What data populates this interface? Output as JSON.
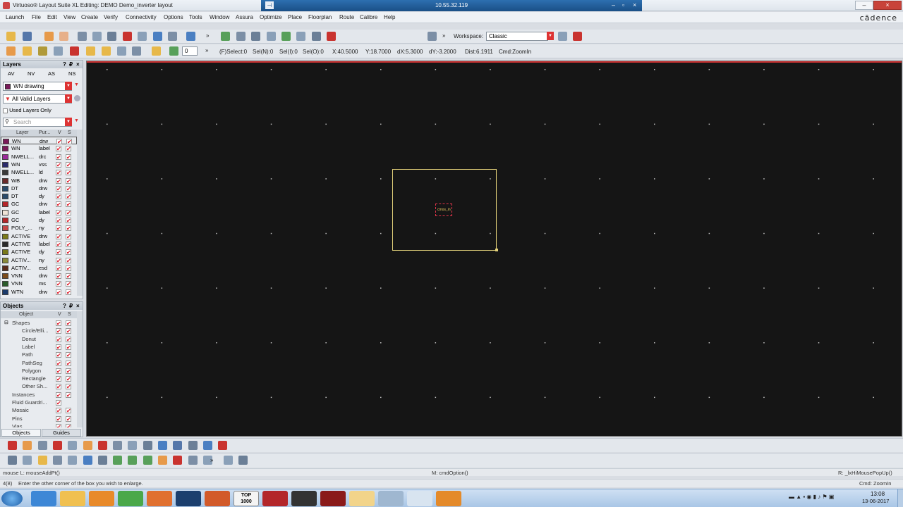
{
  "window": {
    "title": "Virtuoso® Layout Suite XL Editing: DEMO Demo_inverter layout",
    "remote_ip": "10.55.32.119",
    "brand": "cādence"
  },
  "menu": [
    "Launch",
    "File",
    "Edit",
    "View",
    "Create",
    "Verify",
    "Connectivity",
    "Options",
    "Tools",
    "Window",
    "Assura",
    "Optimize",
    "Place",
    "Floorplan",
    "Route",
    "Calibre",
    "Help"
  ],
  "toolbar1": {
    "workspace_label": "Workspace:",
    "workspace_value": "Classic"
  },
  "toolbar2": {
    "count_value": "0",
    "status": {
      "select": "(F)Select:0",
      "seln": "Sel(N):0",
      "seli": "Sel(I):0",
      "selo": "Sel(O):0",
      "x": "X:40.5000",
      "y": "Y:18.7000",
      "dx": "dX:5.3000",
      "dy": "dY:-3.2000",
      "dist": "Dist:6.1911",
      "cmd": "Cmd:ZoomIn"
    }
  },
  "layers_panel": {
    "title": "Layers",
    "tabs": [
      "AV",
      "NV",
      "AS",
      "NS"
    ],
    "current_layer": "WN drawing",
    "filter": "All Valid Layers",
    "used_only": "Used Layers Only",
    "search_placeholder": "Search",
    "col_layer": "Layer",
    "col_purpose": "Pur...",
    "col_v": "V",
    "col_s": "S",
    "rows": [
      {
        "layer": "WN",
        "purpose": "drw",
        "color": "#7a1a5a"
      },
      {
        "layer": "WN",
        "purpose": "label",
        "color": "#7a1a5a"
      },
      {
        "layer": "NWELL...",
        "purpose": "drc",
        "color": "#9a2a9a"
      },
      {
        "layer": "WN",
        "purpose": "vss",
        "color": "#2a2a6a"
      },
      {
        "layer": "NWELL...",
        "purpose": "ld",
        "color": "#3a3a3a"
      },
      {
        "layer": "WB",
        "purpose": "drw",
        "color": "#6a2a2a"
      },
      {
        "layer": "DT",
        "purpose": "drw",
        "color": "#2a4a6a"
      },
      {
        "layer": "DT",
        "purpose": "dy",
        "color": "#2a4a6a"
      },
      {
        "layer": "GC",
        "purpose": "drw",
        "color": "#b3262a"
      },
      {
        "layer": "GC",
        "purpose": "label",
        "color": "#efe4d8"
      },
      {
        "layer": "GC",
        "purpose": "dy",
        "color": "#b3262a"
      },
      {
        "layer": "POLY_...",
        "purpose": "ny",
        "color": "#c44848"
      },
      {
        "layer": "ACTIVE",
        "purpose": "drw",
        "color": "#7a7a1a"
      },
      {
        "layer": "ACTIVE",
        "purpose": "label",
        "color": "#2a2a2a"
      },
      {
        "layer": "ACTIVE",
        "purpose": "dy",
        "color": "#7a7a1a"
      },
      {
        "layer": "ACTIV...",
        "purpose": "ny",
        "color": "#8a8a3a"
      },
      {
        "layer": "ACTIV...",
        "purpose": "esd",
        "color": "#5a2a1a"
      },
      {
        "layer": "VNN",
        "purpose": "drw",
        "color": "#7a4a1a"
      },
      {
        "layer": "VNN",
        "purpose": "ms",
        "color": "#2a5a2a"
      },
      {
        "layer": "WTN",
        "purpose": "drw",
        "color": "#1a3a6a"
      }
    ]
  },
  "objects_panel": {
    "title": "Objects",
    "col_object": "Object",
    "col_v": "V",
    "col_s": "S",
    "rows": [
      "Shapes",
      "Circle/Elli...",
      "Donut",
      "Label",
      "Path",
      "PathSeg",
      "Polygon",
      "Rectangle",
      "Other Sh...",
      "Instances",
      "Fluid Guardri...",
      "Mosaic",
      "Pins",
      "Vias"
    ],
    "tabs": [
      "Objects",
      "Guides"
    ]
  },
  "canvas": {
    "instance_label": "cmos_in"
  },
  "statusbar": {
    "mouse_left": "mouse L: mouseAddPt()",
    "mouse_mid": "M: cmdOption()",
    "mouse_right": "R: _lxHiMousePopUp()",
    "line_num": "4(8)",
    "prompt": "Enter the other corner of the box you wish to enlarge.",
    "cmd": "Cmd: ZoomIn"
  },
  "taskbar": {
    "time": "13:08",
    "date": "13-06-2017",
    "apps": [
      "start-orb-icon",
      "ie-icon",
      "explorer-icon",
      "media-icon",
      "chrome-icon",
      "firefox-icon",
      "photoshop-icon",
      "matlab-icon",
      "top1000-icon",
      "filezilla-icon",
      "inkscape-icon",
      "acrobat-icon",
      "folder-icon",
      "remote-desktop-icon",
      "xming-icon",
      "xlaunch-icon"
    ],
    "top_label": "TOP\n1000"
  },
  "colors": {
    "canvas_bg": "#151515",
    "prbox": "#e4d27a",
    "instance_box": "#e2354a",
    "accent_red": "#d33"
  }
}
